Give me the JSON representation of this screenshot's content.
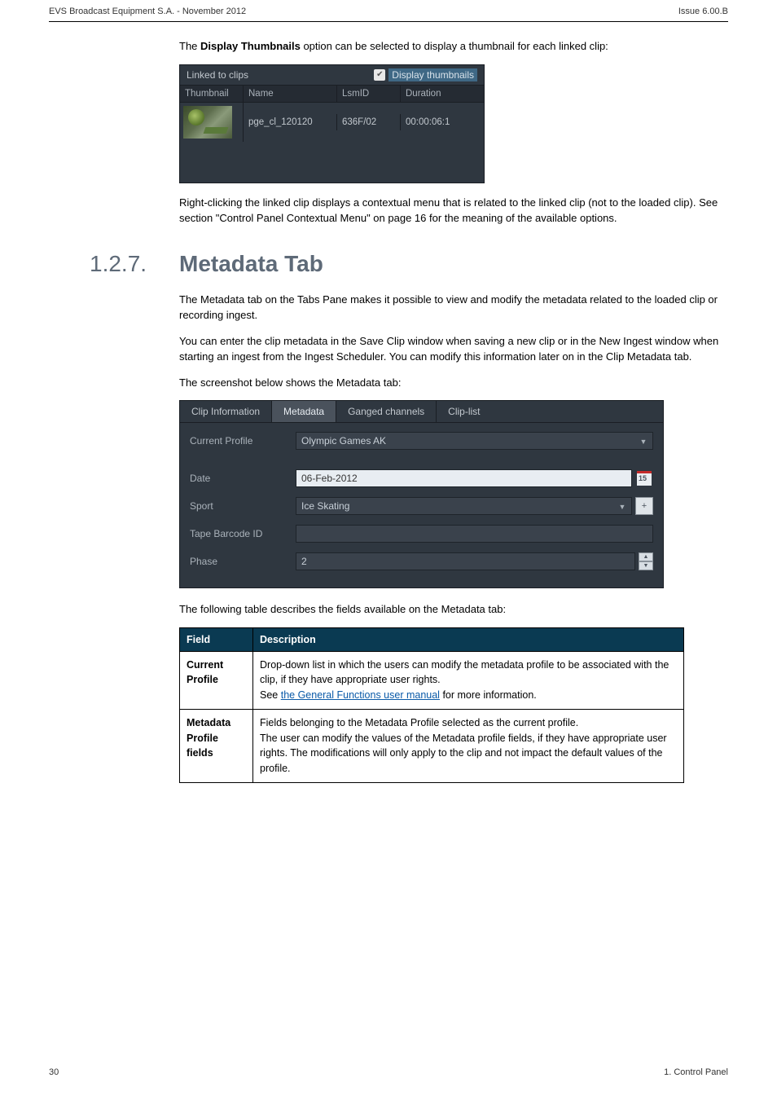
{
  "header": {
    "left": "EVS Broadcast Equipment S.A. - November 2012",
    "right": "Issue 6.00.B"
  },
  "intro1": "option can be selected to display a thumbnail for each linked clip:",
  "intro1_pre": "The ",
  "intro1_bold": "Display Thumbnails",
  "ss1": {
    "title": "Linked to clips",
    "display_th": "Display thumbnails",
    "cols": {
      "thumb": "Thumbnail",
      "name": "Name",
      "lsm": "LsmID",
      "dur": "Duration"
    },
    "row": {
      "name": "pge_cl_120120",
      "lsm": "636F/02",
      "dur": "00:00:06:1"
    }
  },
  "after_ss1": "Right-clicking the linked clip displays a contextual menu that is related to the linked clip (not to the loaded clip). See section \"Control Panel Contextual Menu\" on page 16 for the meaning of the available options.",
  "heading": {
    "num": "1.2.7.",
    "title": "Metadata Tab"
  },
  "para1": "The Metadata tab on the Tabs Pane makes it possible to view and modify the metadata related to the loaded clip or recording ingest.",
  "para2": "You can enter the clip metadata in the Save Clip window when saving a new clip or in the New Ingest window when starting an ingest from the Ingest Scheduler. You can modify this information later on in the Clip Metadata tab.",
  "para3": "The screenshot below shows the Metadata tab:",
  "ss2": {
    "tabs": [
      "Clip Information",
      "Metadata",
      "Ganged channels",
      "Clip-list"
    ],
    "profile_label": "Current Profile",
    "profile_value": "Olympic Games AK",
    "date_label": "Date",
    "date_value": "06-Feb-2012",
    "sport_label": "Sport",
    "sport_value": "Ice Skating",
    "tape_label": "Tape Barcode ID",
    "tape_value": "",
    "phase_label": "Phase",
    "phase_value": "2",
    "plus_label": "+"
  },
  "table_intro": "The following table describes the fields available on the Metadata tab:",
  "table": {
    "th_field": "Field",
    "th_desc": "Description",
    "r1_f": "Current Profile",
    "r1_d1": "Drop-down list in which the users can modify the metadata profile to be associated with the clip, if they have appropriate user rights.",
    "r1_d2a": "See ",
    "r1_d2b": "the General Functions user manual",
    "r1_d2c": " for more information.",
    "r2_f": "Metadata Profile fields",
    "r2_d1": "Fields belonging to the Metadata Profile selected as the current profile.",
    "r2_d2": "The user can modify the values of the Metadata profile fields, if they have appropriate user rights. The modifications will only apply to the clip and not impact the default values of the profile."
  },
  "footer": {
    "left": "30",
    "right": "1. Control Panel"
  }
}
